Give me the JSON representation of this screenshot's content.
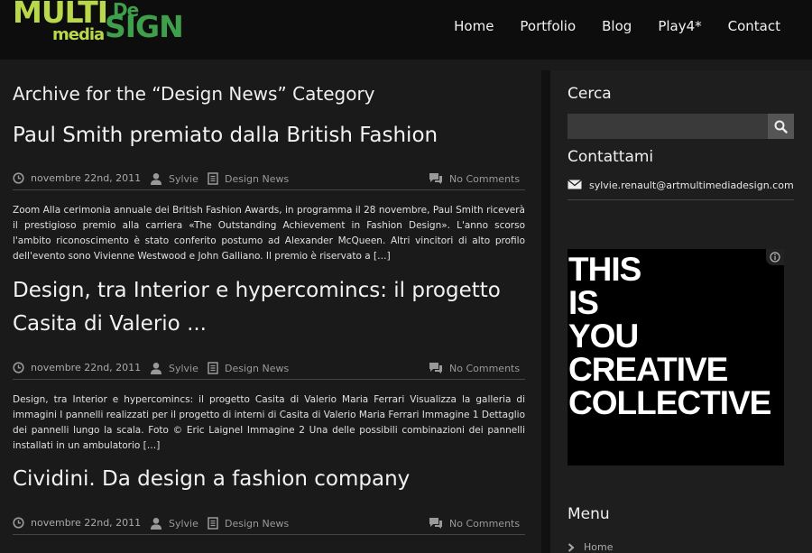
{
  "header": {
    "logo": {
      "multi": "MULTI",
      "de": "De",
      "media": "media",
      "sign": "SIGN"
    },
    "nav": [
      "Home",
      "Portfolio",
      "Blog",
      "Play4*",
      "Contact"
    ]
  },
  "main": {
    "archive_title": "Archive for the “Design News” Category",
    "posts": [
      {
        "title": "Paul Smith premiato dalla British Fashion",
        "date": "novembre 22nd, 2011",
        "author": "Sylvie",
        "category": "Design News",
        "comments": "No Comments",
        "excerpt": "Zoom Alla cerimonia annuale dei British Fashion Awards, in programma il 28 novembre, Paul Smith riceverà il prestigioso premio alla carriera «The Outstanding Achievement in Fashion Design». L'anno scorso l'ambito riconoscimento è stato conferito postumo ad Alexander McQueen. Altri vincitori di alto profilo dell'evento sono Vivienne Westwood e John Galliano. Il premio è riservato a […]"
      },
      {
        "title": "Design, tra Interior e hypercomincs: il progetto Casita di Valerio ...",
        "date": "novembre 22nd, 2011",
        "author": "Sylvie",
        "category": "Design News",
        "comments": "No Comments",
        "excerpt": "Design, tra Interior e hypercomincs: il progetto Casita di Valerio Maria Ferrari Visualizza la galleria di immagini I pannelli realizzati per il progetto di interni di Casita di Valerio Maria Ferrari Immagine 1 Dettaglio dei pannelli lungo la scala. Foto © Eric Laignel Immagine 2 Una delle possibili combinazioni dei pannelli installati in un ambulatorio […]"
      },
      {
        "title": "Cividini. Da design a fashion company",
        "date": "novembre 22nd, 2011",
        "author": "Sylvie",
        "category": "Design News",
        "comments": "No Comments"
      }
    ]
  },
  "sidebar": {
    "search_heading": "Cerca",
    "contact_heading": "Contattami",
    "contact_email": "sylvie.renault@artmultimediadesign.com",
    "ad_lines": [
      "THIS",
      "IS",
      "YOU",
      "CREATIVE",
      "COLLECTIVE"
    ],
    "menu_heading": "Menu",
    "menu_items": [
      "Home"
    ]
  },
  "colors": {
    "background": "#1a1a1a",
    "header": "#0d0d0d",
    "logo_light_green": "#b9d84a",
    "logo_dark_green": "#3ea04a",
    "search_bg": "#3a3a3a"
  },
  "icons": [
    "clock-icon",
    "user-icon",
    "document-icon",
    "comments-icon",
    "search-icon",
    "envelope-icon",
    "chevron-right-icon",
    "info-icon"
  ]
}
